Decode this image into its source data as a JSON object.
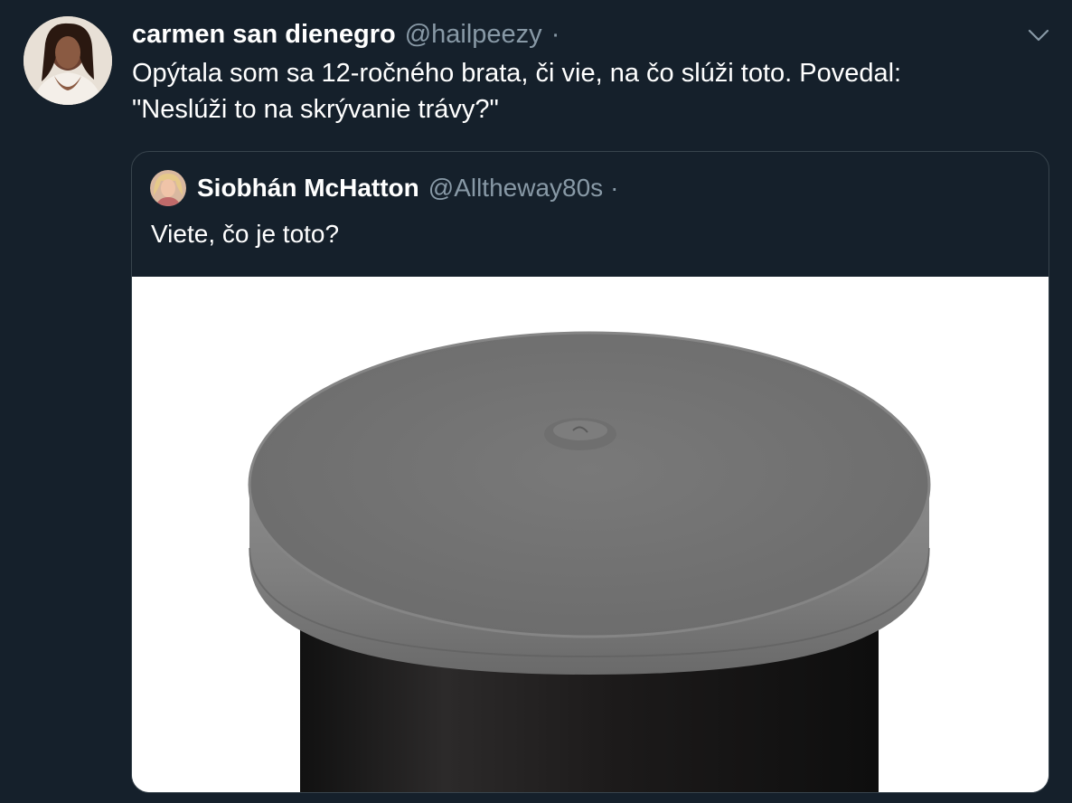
{
  "tweet": {
    "display_name": "carmen san dienegro",
    "handle": "@hailpeezy",
    "separator": "·",
    "text": "Opýtala som sa 12-ročného brata, či vie, na čo slúži toto. Povedal:\n\"Neslúži to na skrývanie trávy?\"",
    "avatar_icon": "profile-photo",
    "menu_icon": "chevron-down-icon"
  },
  "quoted_tweet": {
    "display_name": "Siobhán McHatton",
    "handle": "@Alltheway80s",
    "separator": "·",
    "text": "Viete, čo je toto?",
    "avatar_icon": "profile-photo",
    "media_icon": "film-canister-photo"
  },
  "colors": {
    "background": "#15202b",
    "text_primary": "#ffffff",
    "text_secondary": "#8899a6",
    "border": "#38444d"
  }
}
